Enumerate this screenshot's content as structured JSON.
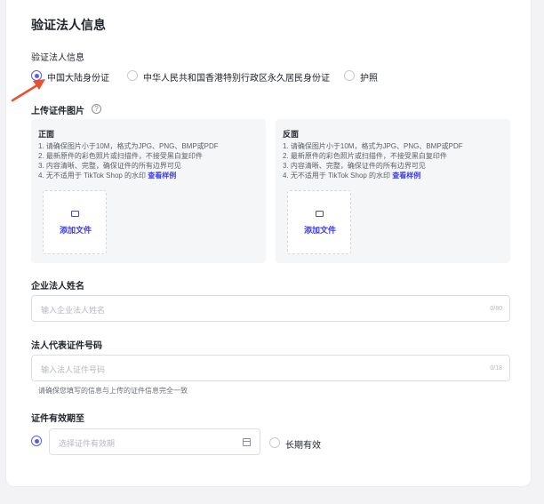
{
  "section_title": "验证法人信息",
  "id_type": {
    "label": "验证法人信息",
    "options": [
      {
        "label": "中国大陆身份证",
        "selected": true
      },
      {
        "label": "中华人民共和国香港特别行政区永久居民身份证",
        "selected": false
      },
      {
        "label": "护照",
        "selected": false
      }
    ]
  },
  "upload": {
    "label": "上传证件图片",
    "help_icon": "?",
    "front": {
      "title": "正面",
      "rules": [
        "1. 请确保图片小于10M，格式为JPG、PNG、BMP或PDF",
        "2. 最新原件的彩色照片或扫描件，不接受黑白复印件",
        "3. 内容清晰、完整，确保证件的所有边界可见"
      ],
      "rule4_text": "4. 无不适用于 TikTok Shop 的水印",
      "rule4_link": "查看样例",
      "button_label": "添加文件"
    },
    "back": {
      "title": "反面",
      "rules": [
        "1. 请确保图片小于10M，格式为JPG、PNG、BMP或PDF",
        "2. 最新原件的彩色照片或扫描件，不接受黑白复印件",
        "3. 内容清晰、完整，确保证件的所有边界可见"
      ],
      "rule4_text": "4. 无不适用于 TikTok Shop 的水印",
      "rule4_link": "查看样例",
      "button_label": "添加文件"
    }
  },
  "legal_name": {
    "label": "企业法人姓名",
    "placeholder": "输入企业法人姓名",
    "counter": "0/80"
  },
  "id_number": {
    "label": "法人代表证件号码",
    "placeholder": "输入法人证件号码",
    "counter": "0/18",
    "hint": "请确保您填写的信息与上传的证件信息完全一致"
  },
  "validity": {
    "label": "证件有效期至",
    "date_placeholder": "选择证件有效期",
    "long_term_label": "长期有效"
  },
  "colors": {
    "accent": "#5b5bf0",
    "link": "#3d3ded",
    "annotation_arrow": "#e8532a"
  }
}
